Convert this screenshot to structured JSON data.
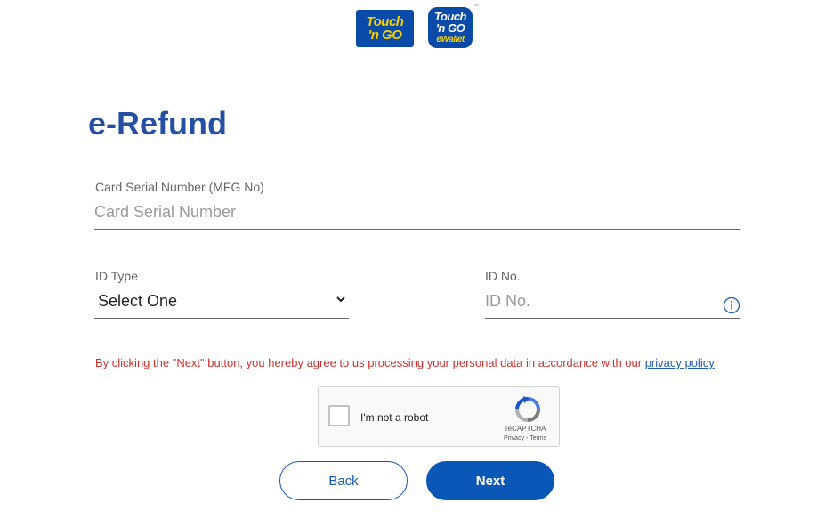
{
  "header": {
    "logo_tng_line1": "Touch",
    "logo_tng_line2": "'n GO",
    "logo_ewallet_line1": "Touch",
    "logo_ewallet_line2": "'n GO",
    "logo_ewallet_line3": "eWallet",
    "tm": "™"
  },
  "page": {
    "title": "e-Refund"
  },
  "form": {
    "card_serial": {
      "label": "Card Serial Number (MFG No)",
      "placeholder": "Card Serial Number",
      "value": ""
    },
    "id_type": {
      "label": "ID Type",
      "selected": "Select One"
    },
    "id_no": {
      "label": "ID No.",
      "placeholder": "ID No.",
      "value": ""
    }
  },
  "consent": {
    "text": "By clicking the \"Next\" button, you hereby agree to us processing your personal data in accordance with our ",
    "link": "privacy policy"
  },
  "captcha": {
    "label": "I'm not a robot",
    "brand": "reCAPTCHA",
    "privacy": "Privacy",
    "separator": " - ",
    "terms": "Terms",
    "checked": false
  },
  "buttons": {
    "back": "Back",
    "next": "Next"
  },
  "colors": {
    "title": "#264fa3",
    "primary": "#0b57b8",
    "consent": "#d0302b"
  }
}
